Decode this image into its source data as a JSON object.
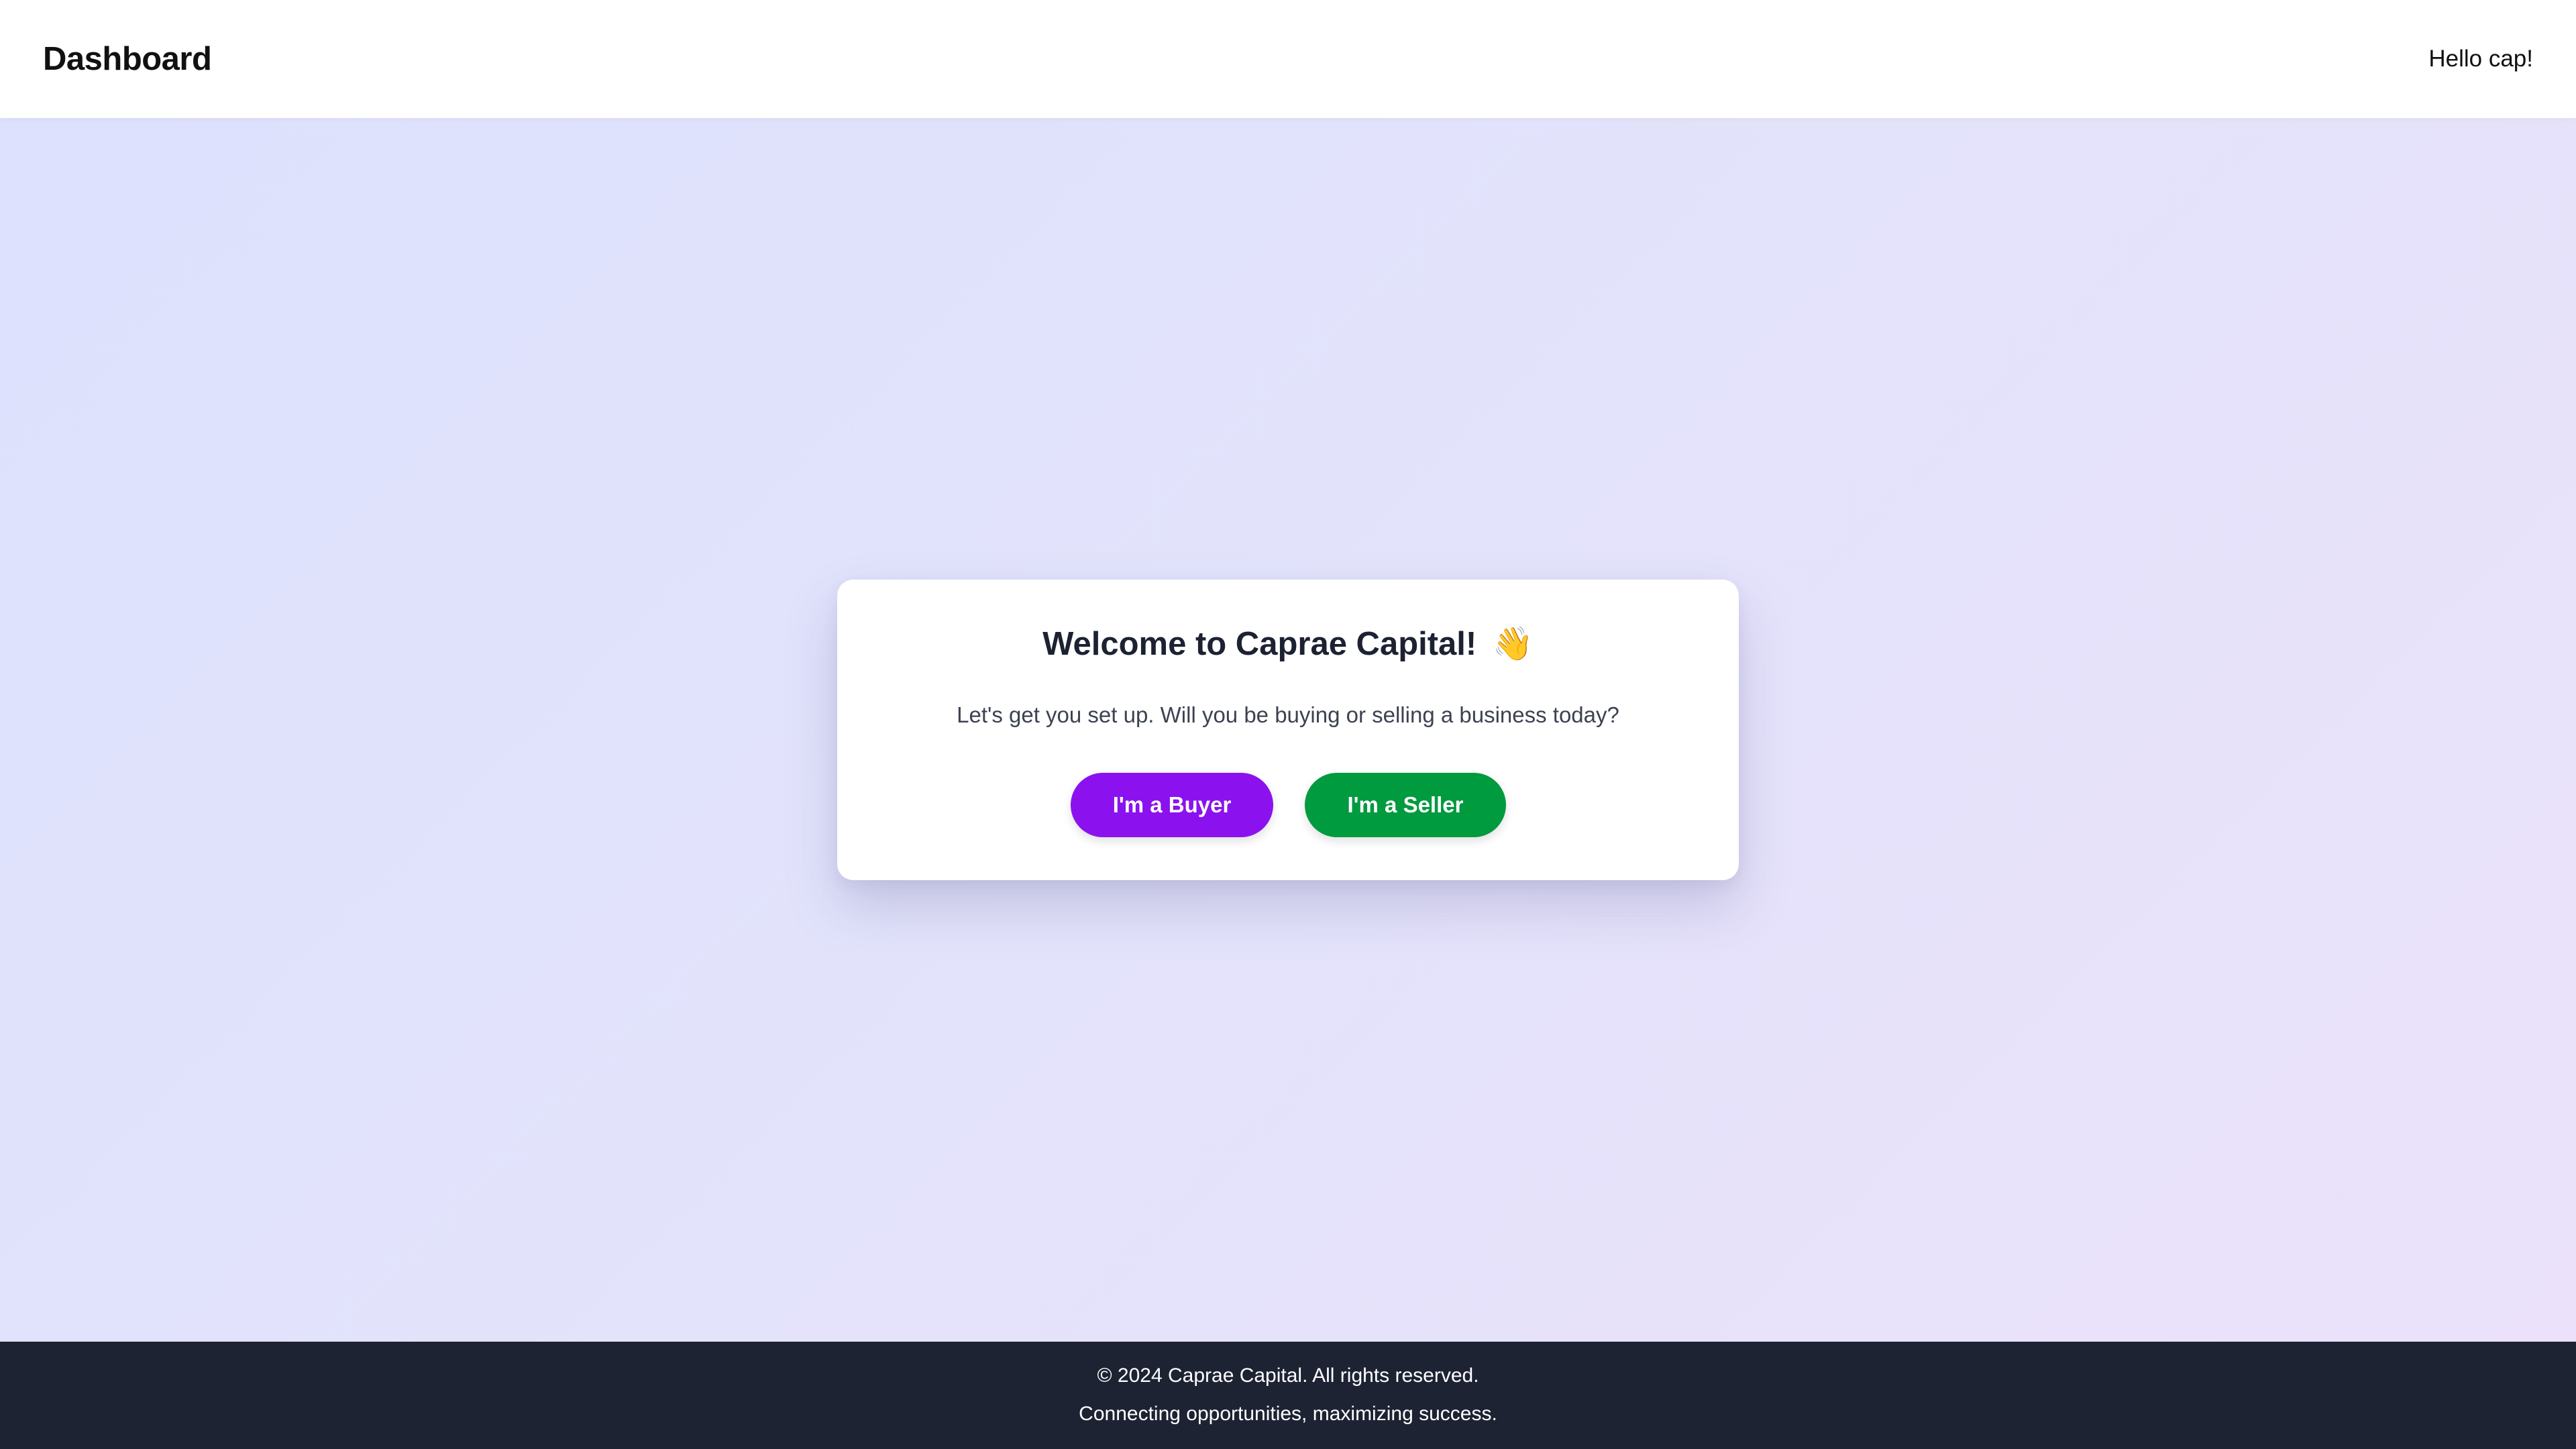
{
  "header": {
    "title": "Dashboard",
    "greeting": "Hello cap!"
  },
  "welcome_card": {
    "title": "Welcome to Caprae Capital!",
    "title_emoji": "👋",
    "subtitle": "Let's get you set up. Will you be buying or selling a business today?",
    "buyer_button_label": "I'm a Buyer",
    "seller_button_label": "I'm a Seller"
  },
  "footer": {
    "copyright": "© 2024 Caprae Capital. All rights reserved.",
    "tagline": "Connecting opportunities, maximizing success."
  },
  "colors": {
    "buyer_button": "#8b12ef",
    "seller_button": "#009a3f",
    "footer_background": "#1d2333",
    "background_gradient_start": "#dde1fd",
    "background_gradient_end": "#ebe1fa"
  },
  "icons": {
    "title_emoji": "waving-hand-icon"
  }
}
